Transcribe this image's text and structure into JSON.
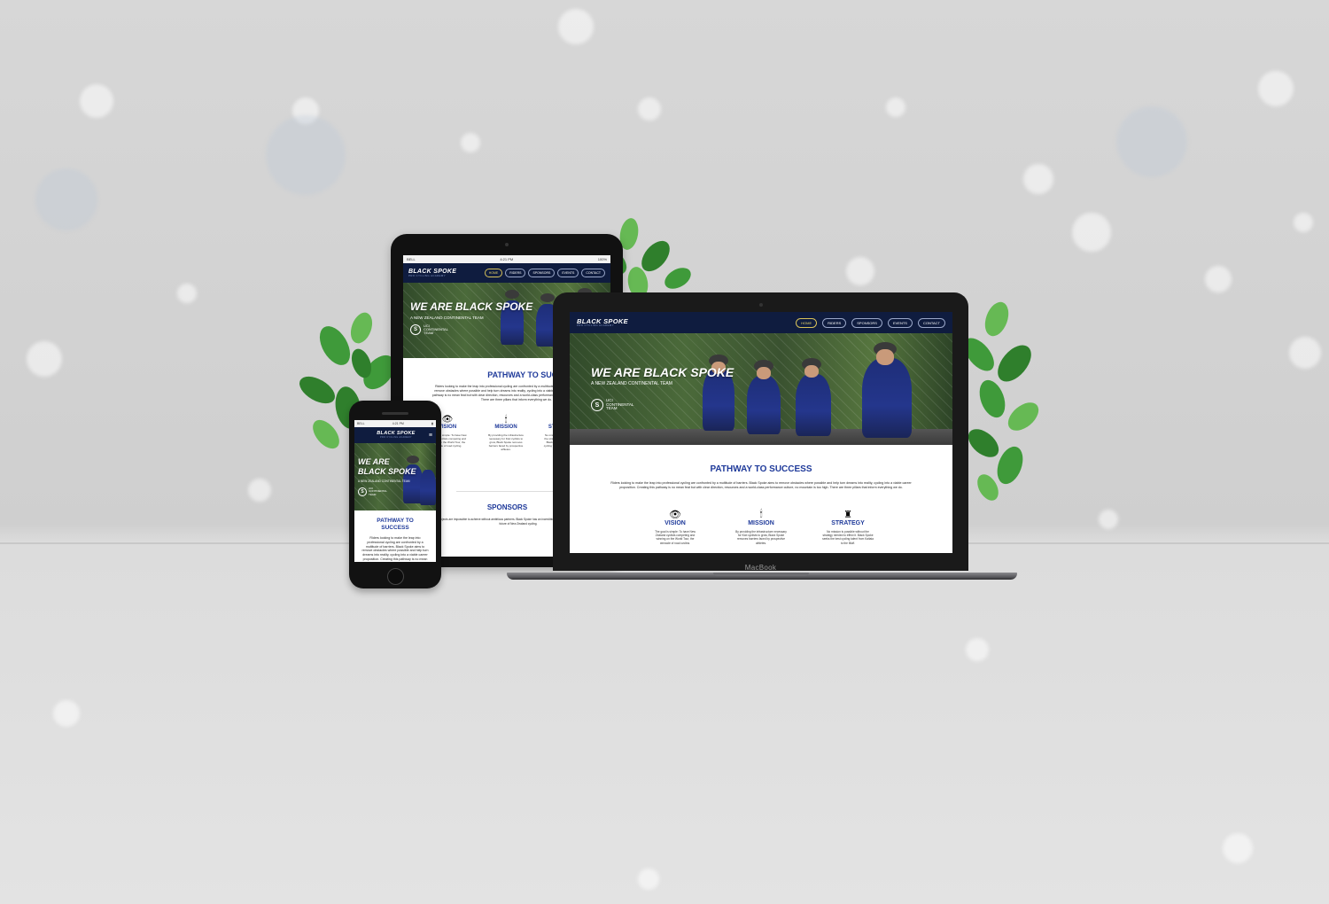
{
  "site": {
    "logo": "BLACK SPOKE",
    "logo_sub": "PRO CYCLING ACADEMY",
    "nav": [
      "HOME",
      "RIDERS",
      "SPONSORS",
      "EVENTS",
      "CONTACT"
    ],
    "hero_title": "WE ARE BLACK SPOKE",
    "hero_title_line1": "WE ARE",
    "hero_title_line2": "BLACK SPOKE",
    "hero_subtitle": "A NEW ZEALAND CONTINENTAL TEAM",
    "uci_mark": "S",
    "uci_line1": "UCI",
    "uci_line2": "CONTINENTAL",
    "uci_line3": "TEAM",
    "pathway_title": "PATHWAY TO SUCCESS",
    "pathway_line1": "PATHWAY TO",
    "pathway_line2": "SUCCESS",
    "pathway_text": "Riders looking to make the leap into professional cycling are confronted by a multitude of barriers. Black Spoke aims to remove obstacles where possible and help turn dreams into reality, cycling into a viable career proposition. Creating this pathway is no mean feat but with clear direction, resources and a world-class performance culture, no mountain is too high. There are three pillars that inform everything we do.",
    "pillars": [
      {
        "name": "VISION",
        "icon": "eye-icon",
        "text": "The goal is simple: To have New Zealand cyclists competing and winning on the World Tour, the pinnacle of road cycling."
      },
      {
        "name": "MISSION",
        "icon": "torch-icon",
        "text": "By providing the infrastructure necessary for Kiwi cyclists to grow, Black Spoke removes barriers faced by prospective athletes."
      },
      {
        "name": "STRATEGY",
        "icon": "rook-icon",
        "text": "No mission is possible without the strategy needed to effect it. Black Spoke seeks the best cycling talent from Kaitaia to the Bluff."
      }
    ],
    "sponsors_title": "SPONSORS",
    "sponsors_text": "Our projects are impossible to achieve without ambitious partners. Black Spoke has an incredible network of brands passionate about the future of New Zealand cycling."
  },
  "tablet_status": {
    "carrier": "BELL",
    "time": "4:21 PM",
    "battery": "100%"
  },
  "phone_status": {
    "carrier": "BELL",
    "time": "4:21 PM"
  },
  "laptop_brand": "MacBook",
  "colors": {
    "navy": "#0f1c3f",
    "accent_blue": "#1f3a9a",
    "active_nav": "#e6d36a"
  }
}
